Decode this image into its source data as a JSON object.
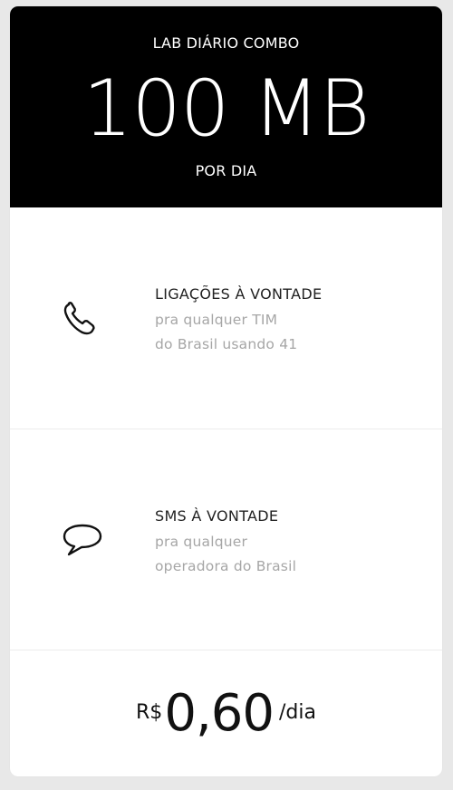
{
  "plan": {
    "name": "LAB DIÁRIO COMBO",
    "data_amount": "100 MB",
    "period": "POR DIA"
  },
  "features": [
    {
      "icon": "phone-icon",
      "title": "LIGAÇÕES À VONTADE",
      "desc_line1": "pra qualquer TIM",
      "desc_line2": "do Brasil usando 41"
    },
    {
      "icon": "chat-bubble-icon",
      "title": "SMS À VONTADE",
      "desc_line1": "pra qualquer",
      "desc_line2": "operadora do Brasil"
    }
  ],
  "price": {
    "currency": "R$",
    "amount": "0,60",
    "unit": "/dia"
  },
  "colors": {
    "header_bg": "#000000",
    "header_text": "#ffffff",
    "desc_text": "#a6a6a6",
    "page_bg": "#e8e8e8"
  }
}
